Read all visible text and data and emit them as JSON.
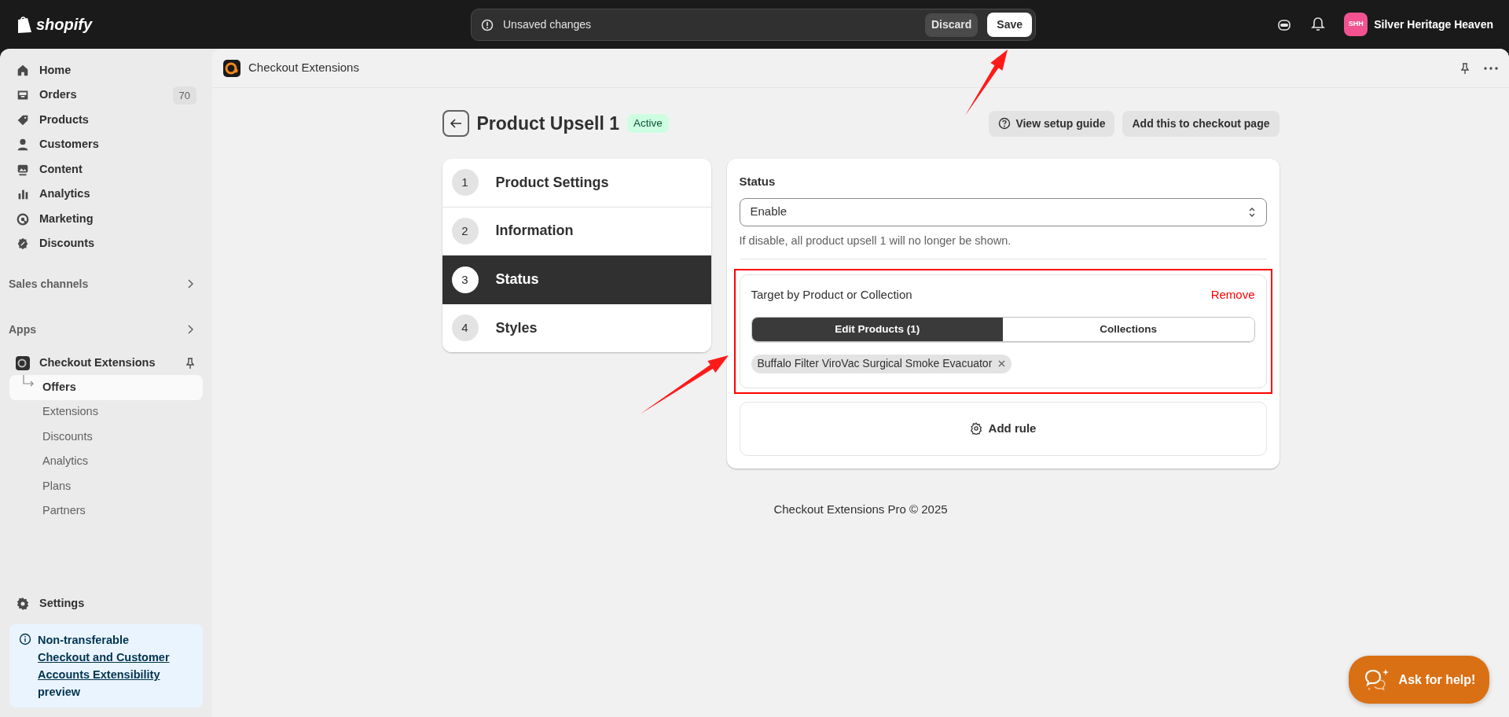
{
  "top_bar": {
    "logo": "shopify",
    "unsaved": "Unsaved changes",
    "discard": "Discard",
    "save": "Save",
    "store_initials": "SHH",
    "store_name": "Silver Heritage Heaven"
  },
  "sidebar": {
    "items": [
      {
        "kind": "home",
        "label": "Home"
      },
      {
        "kind": "orders",
        "label": "Orders",
        "count": "70"
      },
      {
        "kind": "products",
        "label": "Products"
      },
      {
        "kind": "customers",
        "label": "Customers"
      },
      {
        "kind": "content",
        "label": "Content"
      },
      {
        "kind": "analytics",
        "label": "Analytics"
      },
      {
        "kind": "marketing",
        "label": "Marketing"
      },
      {
        "kind": "discounts",
        "label": "Discounts"
      }
    ],
    "sections": [
      "Sales channels",
      "Apps"
    ],
    "app": {
      "label": "Checkout Extensions",
      "children": [
        {
          "label": "Offers",
          "selected": true
        },
        {
          "label": "Extensions",
          "selected": false
        },
        {
          "label": "Discounts",
          "selected": false
        },
        {
          "label": "Analytics",
          "selected": false
        },
        {
          "label": "Plans",
          "selected": false
        },
        {
          "label": "Partners",
          "selected": false
        }
      ]
    },
    "settings": "Settings",
    "notice": {
      "title": "Non-transferable",
      "link": "Checkout and Customer Accounts Extensibility",
      "tail": "preview"
    }
  },
  "app_header": {
    "title": "Checkout Extensions"
  },
  "page": {
    "title": "Product Upsell 1",
    "badge": "Active",
    "buttons": [
      "View setup guide",
      "Add this to checkout page"
    ]
  },
  "steps": [
    {
      "number": "1",
      "label": "Product Settings",
      "selected": false
    },
    {
      "number": "2",
      "label": "Information",
      "selected": false
    },
    {
      "number": "3",
      "label": "Status",
      "selected": true
    },
    {
      "number": "4",
      "label": "Styles",
      "selected": false
    }
  ],
  "status_card": {
    "label": "Status",
    "value": "Enable",
    "help": "If disable, all product upsell 1 will no longer be shown.",
    "rule": {
      "title": "Target by Product or Collection",
      "remove": "Remove",
      "tabs": [
        {
          "label": "Edit Products (1)",
          "selected": true
        },
        {
          "label": "Collections",
          "selected": false
        }
      ],
      "tags": [
        "Buffalo Filter ViroVac Surgical Smoke Evacuator"
      ]
    },
    "add_rule": "Add rule"
  },
  "footer": "Checkout Extensions Pro © 2025",
  "help_button": "Ask for help!",
  "annotations": [
    {
      "kind": "box"
    },
    {
      "kind": "arrow"
    },
    {
      "kind": "arrow"
    }
  ]
}
